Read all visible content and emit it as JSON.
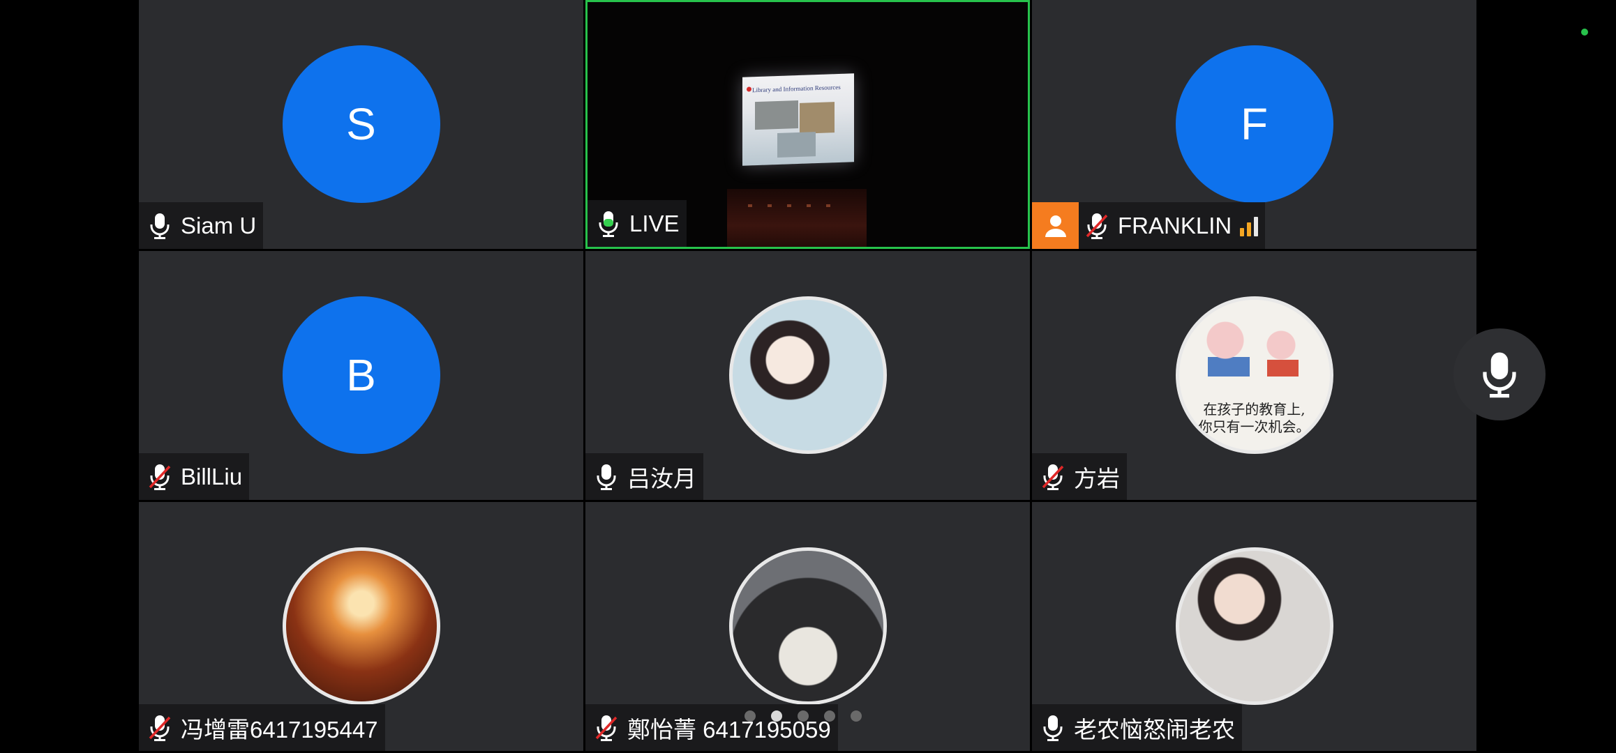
{
  "participants": [
    {
      "initial": "S",
      "name": "Siam U",
      "mic": "on",
      "avatar_type": "letter"
    },
    {
      "name": "LIVE",
      "mic": "active",
      "avatar_type": "video",
      "slide_title": "Library and Information Resources"
    },
    {
      "initial": "F",
      "name": "FRANKLIN",
      "mic": "muted",
      "avatar_type": "letter",
      "host_badge": true,
      "signal": "weak"
    },
    {
      "initial": "B",
      "name": "BillLiu",
      "mic": "muted",
      "avatar_type": "letter"
    },
    {
      "name": "吕汝月",
      "mic": "on",
      "avatar_type": "photo"
    },
    {
      "name": "方岩",
      "mic": "muted",
      "avatar_type": "photo",
      "avatar_caption_line1": "在孩子的教育上,",
      "avatar_caption_line2": "你只有一次机会。"
    },
    {
      "name": "冯增雷6417195447",
      "mic": "muted",
      "avatar_type": "photo"
    },
    {
      "name": "鄭怡菁 6417195059",
      "mic": "muted",
      "avatar_type": "photo"
    },
    {
      "name": "老农恼怒闹老农",
      "mic": "on",
      "avatar_type": "photo"
    }
  ],
  "pagination": {
    "total": 5,
    "active_index": 1
  },
  "colors": {
    "accent_blue": "#0e72ed",
    "active_border": "#27c24c",
    "host_badge": "#f57c1f",
    "tile_bg": "#2b2c2f"
  },
  "icons": {
    "mic": "microphone-icon",
    "mic_muted": "microphone-muted-icon",
    "host": "person-icon",
    "signal": "signal-bars-icon",
    "floating_mic": "microphone-icon"
  }
}
